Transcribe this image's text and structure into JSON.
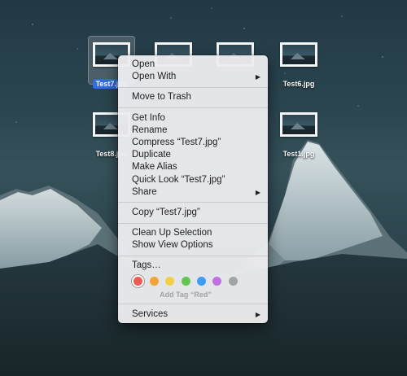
{
  "desktop": {
    "icons": [
      {
        "name": "Test7.jpg",
        "selected": true
      },
      {
        "name": "",
        "selected": false
      },
      {
        "name": "",
        "selected": false
      },
      {
        "name": "Test6.jpg",
        "selected": false
      },
      {
        "name": "Test8.jpg",
        "selected": false
      },
      {
        "name": "Test1.jpg",
        "selected": false
      }
    ]
  },
  "context_menu": {
    "open": "Open",
    "open_with": "Open With",
    "move_to_trash": "Move to Trash",
    "get_info": "Get Info",
    "rename": "Rename",
    "compress": "Compress “Test7.jpg”",
    "duplicate": "Duplicate",
    "make_alias": "Make Alias",
    "quick_look": "Quick Look “Test7.jpg”",
    "share": "Share",
    "copy": "Copy “Test7.jpg”",
    "clean_up_selection": "Clean Up Selection",
    "show_view_options": "Show View Options",
    "tags": "Tags…",
    "tag_colors": [
      {
        "name": "red",
        "color": "#ec5b56",
        "selected": true
      },
      {
        "name": "orange",
        "color": "#f2a33c",
        "selected": false
      },
      {
        "name": "yellow",
        "color": "#f3cf45",
        "selected": false
      },
      {
        "name": "green",
        "color": "#62c655",
        "selected": false
      },
      {
        "name": "blue",
        "color": "#3f9cf2",
        "selected": false
      },
      {
        "name": "purple",
        "color": "#c26fe3",
        "selected": false
      },
      {
        "name": "gray",
        "color": "#a3a3a7",
        "selected": false
      }
    ],
    "add_tag_hint": "Add Tag “Red”",
    "services": "Services",
    "submenu_arrow": "▶"
  }
}
